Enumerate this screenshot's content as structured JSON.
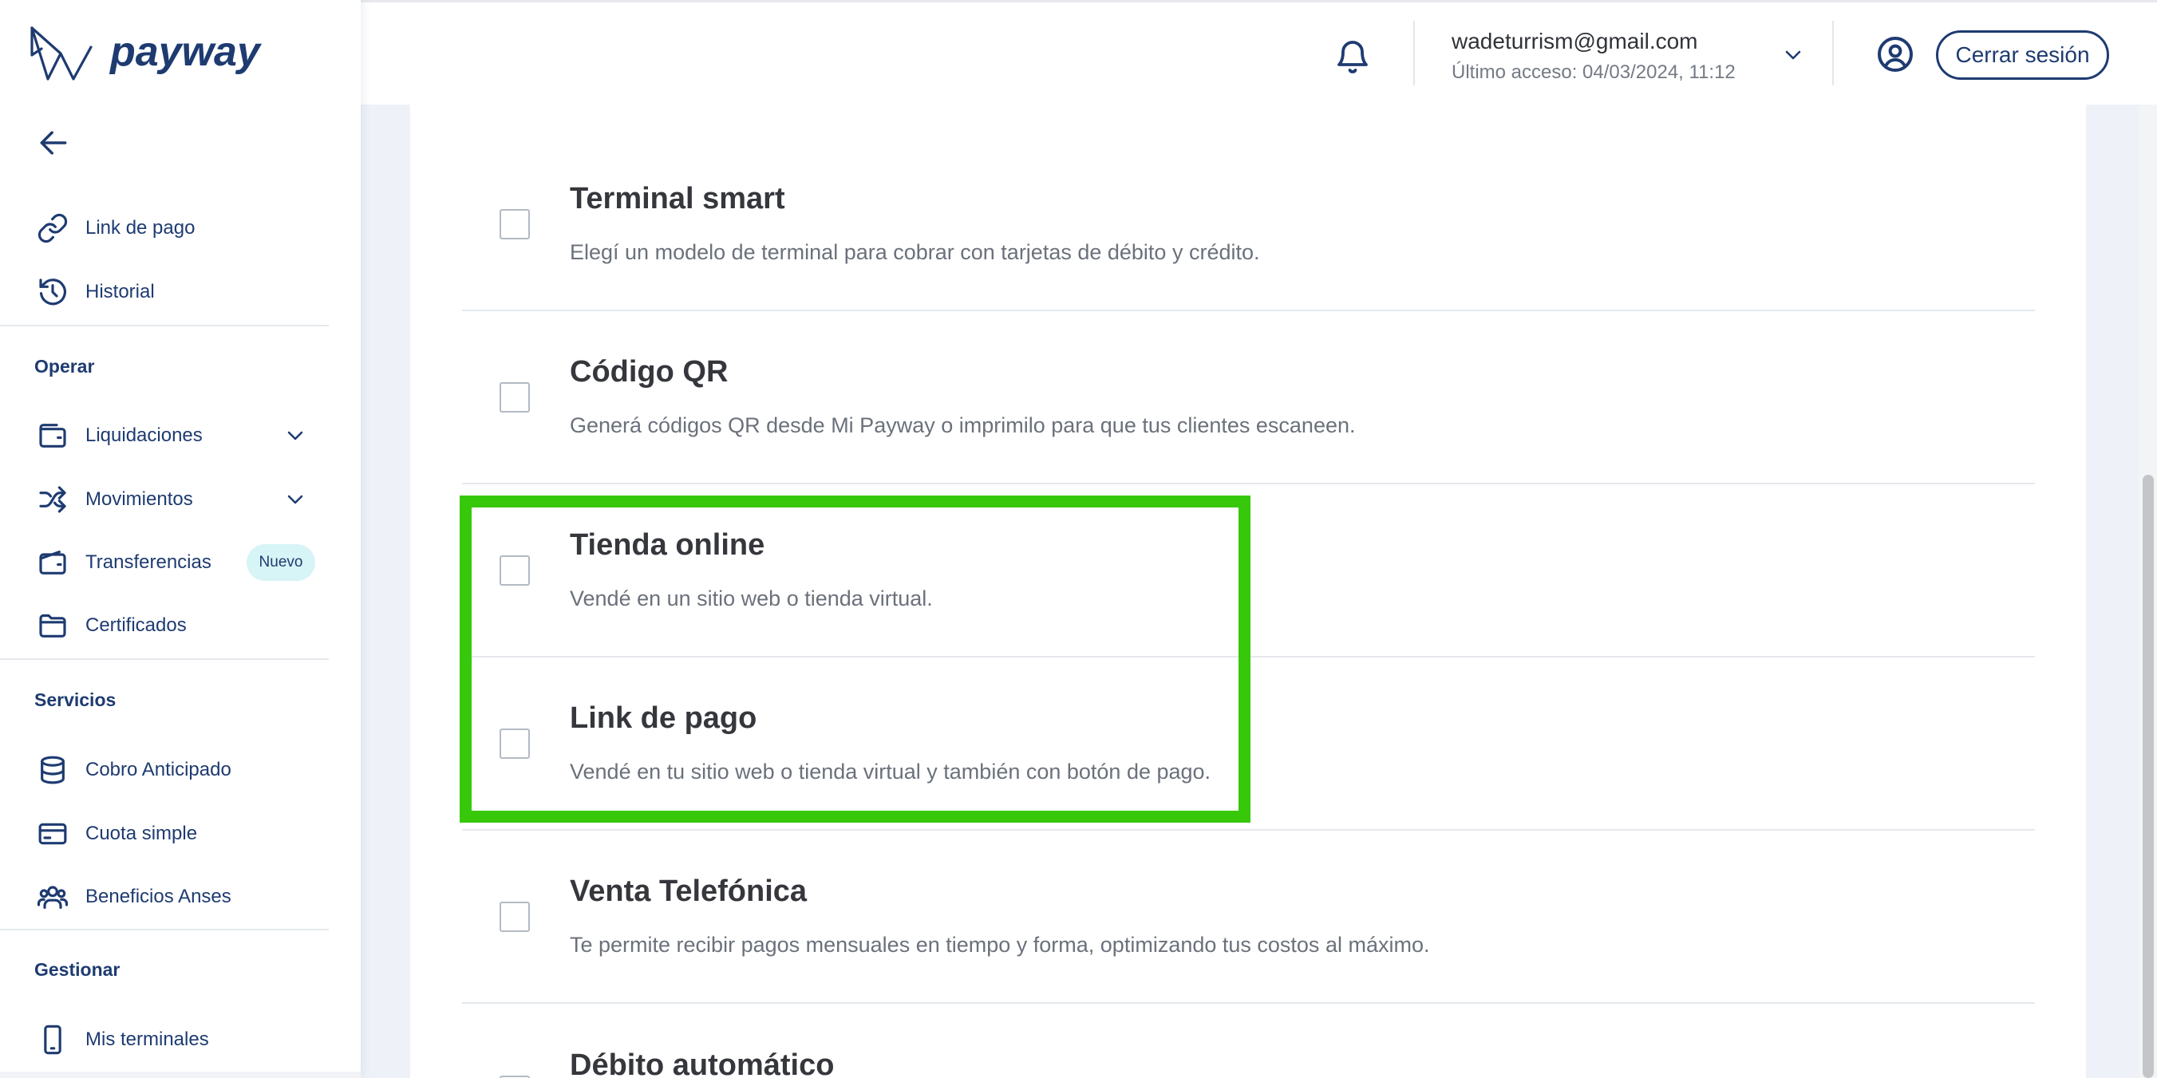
{
  "app": {
    "logo_text": "payway"
  },
  "sidebar": {
    "back_icon": "arrow-left-icon",
    "top_items": [
      {
        "label": "Link de pago",
        "icon": "link-icon"
      },
      {
        "label": "Historial",
        "icon": "history-icon"
      }
    ],
    "sections": [
      {
        "title": "Operar",
        "items": [
          {
            "label": "Liquidaciones",
            "icon": "wallet-icon",
            "expand_icon": "chevron-down-icon"
          },
          {
            "label": "Movimientos",
            "icon": "shuffle-icon",
            "expand_icon": "chevron-down-icon"
          },
          {
            "label": "Transferencias",
            "icon": "wallet-icon",
            "badge": "Nuevo"
          },
          {
            "label": "Certificados",
            "icon": "folder-icon"
          }
        ]
      },
      {
        "title": "Servicios",
        "items": [
          {
            "label": "Cobro Anticipado",
            "icon": "database-icon"
          },
          {
            "label": "Cuota simple",
            "icon": "credit-card-icon"
          },
          {
            "label": "Beneficios Anses",
            "icon": "users-icon"
          }
        ]
      },
      {
        "title": "Gestionar",
        "items": [
          {
            "label": "Mis terminales",
            "icon": "mobile-phone-icon"
          }
        ]
      }
    ]
  },
  "header": {
    "notifications_icon": "bell-icon",
    "user_email": "wadeturrism@gmail.com",
    "last_access": "Último acceso: 04/03/2024, 11:12",
    "account_menu_icon": "chevron-down-icon",
    "profile_icon": "user-circle-icon",
    "logout_label": "Cerrar sesión"
  },
  "options": [
    {
      "title": "Terminal smart",
      "description": "Elegí un modelo de terminal para cobrar con tarjetas de débito y crédito.",
      "checked": false
    },
    {
      "title": "Código QR",
      "description": "Generá códigos QR desde Mi Payway o imprimilo para que tus clientes escaneen.",
      "checked": false
    },
    {
      "title": "Tienda online",
      "description": "Vendé en un sitio web o tienda virtual.",
      "checked": false,
      "highlighted": true
    },
    {
      "title": "Link de pago",
      "description": "Vendé en tu sitio web o tienda virtual y también con botón de pago.",
      "checked": false,
      "highlighted": true
    },
    {
      "title": "Venta Telefónica",
      "description": "Te permite recibir pagos mensuales en tiempo y forma, optimizando tus costos al máximo.",
      "checked": false
    },
    {
      "title": "Débito automático",
      "checked": false
    }
  ],
  "colors": {
    "brand_navy": "#1e3b71",
    "highlight_green": "#37c80c",
    "badge_background": "#d7f4f6",
    "page_background": "#eef2f8",
    "title_text": "#35373c",
    "description_text": "#6b717b",
    "divider": "#e5e8ec"
  }
}
